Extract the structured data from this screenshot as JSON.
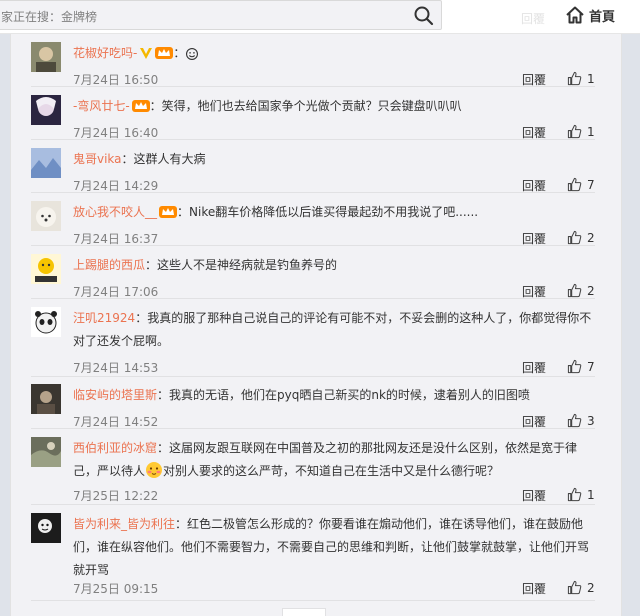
{
  "search": {
    "text": "家正在搜：金牌榜"
  },
  "header": {
    "ghost_reply": "回覆",
    "home_label": "首頁"
  },
  "comments": [
    {
      "name": "花椒好吃吗-",
      "text": "：",
      "time": "7月24日 16:50",
      "reply": "回覆",
      "likes": "1",
      "badges": [
        "v",
        "crown"
      ],
      "smile": true
    },
    {
      "name": "-弯风廿七-",
      "text": "：笑得，牠们也去给国家争个光做个贡献？只会键盘叭叭叭",
      "time": "7月24日 16:40",
      "reply": "回覆",
      "likes": "1",
      "badges": [
        "crown"
      ]
    },
    {
      "name": "鬼哥vika",
      "text": "：这群人有大病",
      "time": "7月24日 14:29",
      "reply": "回覆",
      "likes": "7",
      "badges": []
    },
    {
      "name": "放心我不咬人__",
      "text": "：Nike翻车价格降低以后谁买得最起劲不用我说了吧......",
      "time": "7月24日 16:37",
      "reply": "回覆",
      "likes": "2",
      "badges": [
        "crown"
      ]
    },
    {
      "name": "上踢腿的西瓜",
      "text": "：这些人不是神经病就是钓鱼养号的",
      "time": "7月24日 17:06",
      "reply": "回覆",
      "likes": "2",
      "badges": []
    },
    {
      "name": "汪叽21924",
      "text": "：我真的服了那种自己说自己的评论有可能不对，不妥会删的这种人了，你都觉得你不对了还发个屁啊。",
      "time": "7月24日 14:53",
      "reply": "回覆",
      "likes": "7",
      "badges": []
    },
    {
      "name": "临安屿的塔里斯",
      "text": "：我真的无语，他们在pyq晒自己新买的nk的时候，逮着别人的旧图喷",
      "time": "7月24日 14:52",
      "reply": "回覆",
      "likes": "3",
      "badges": []
    },
    {
      "name": "西伯利亚的冰窟",
      "text_a": "：这届网友跟互联网在中国普及之初的那批网友还是没什么区别，依然是宽于律己，严以待人",
      "text_b": "对别人要求的这么严苛，不知道自己在生活中又是什么德行呢？",
      "time": "7月25日 12:22",
      "reply": "回覆",
      "likes": "1",
      "badges": []
    },
    {
      "name": "皆为利来_皆为利往",
      "text": "：红色二极管怎么形成的？你要看谁在煽动他们，谁在诱导他们，谁在鼓励他们，谁在纵容他们。他们不需要智力，不需要自己的思维和判断，让他们鼓掌就鼓掌，让他们开骂就开骂",
      "time": "7月25日 09:15",
      "reply": "回覆",
      "likes": "2",
      "badges": []
    }
  ],
  "colors": {
    "name_link": "#eb7350",
    "page_bg": "#dfe3ea",
    "panel_bg": "#f2f2f5"
  }
}
